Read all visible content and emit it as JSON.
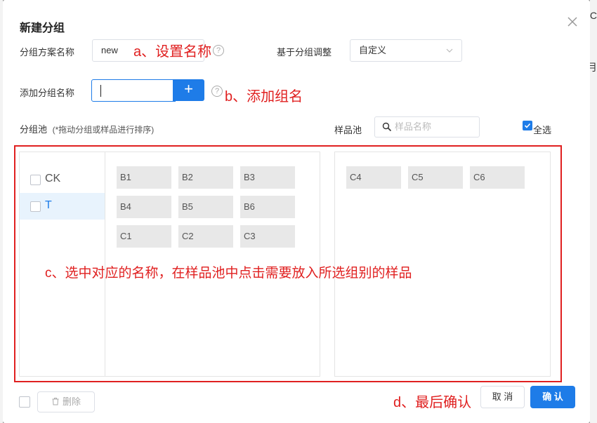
{
  "background": {
    "edge_char_top": "C",
    "edge_char_mid": "月"
  },
  "dialog": {
    "title": "新建分组",
    "close_icon": "close-icon"
  },
  "form": {
    "scheme_name_label": "分组方案名称",
    "scheme_name_value": "new",
    "base_adjust_label": "基于分组调整",
    "base_adjust_value": "自定义",
    "add_group_label": "添加分组名称",
    "add_group_value": "",
    "add_button_label": "+",
    "help_glyph": "?"
  },
  "annotations": {
    "a": "a、设置名称",
    "b": "b、添加组名",
    "c": "c、选中对应的名称，在样品池中点击需要放入所选组别的样品",
    "d": "d、最后确认"
  },
  "pools": {
    "group_pool_label": "分组池",
    "group_pool_hint": "(*拖动分组或样品进行排序)",
    "sample_pool_label": "样品池",
    "sample_search_placeholder": "样品名称",
    "select_all_label": "全选",
    "select_all_checked": true
  },
  "groups": [
    {
      "name": "CK",
      "active": false
    },
    {
      "name": "T",
      "active": true
    }
  ],
  "group_samples": [
    "B1",
    "B2",
    "B3",
    "B4",
    "B5",
    "B6",
    "C1",
    "C2",
    "C3"
  ],
  "sample_pool": [
    "C4",
    "C5",
    "C6"
  ],
  "footer": {
    "delete_label": "删除",
    "cancel_label": "取 消",
    "confirm_label": "确 认"
  },
  "colors": {
    "primary": "#1e7ce8",
    "annotation": "#e02020",
    "chip": "#e8e8e8"
  }
}
